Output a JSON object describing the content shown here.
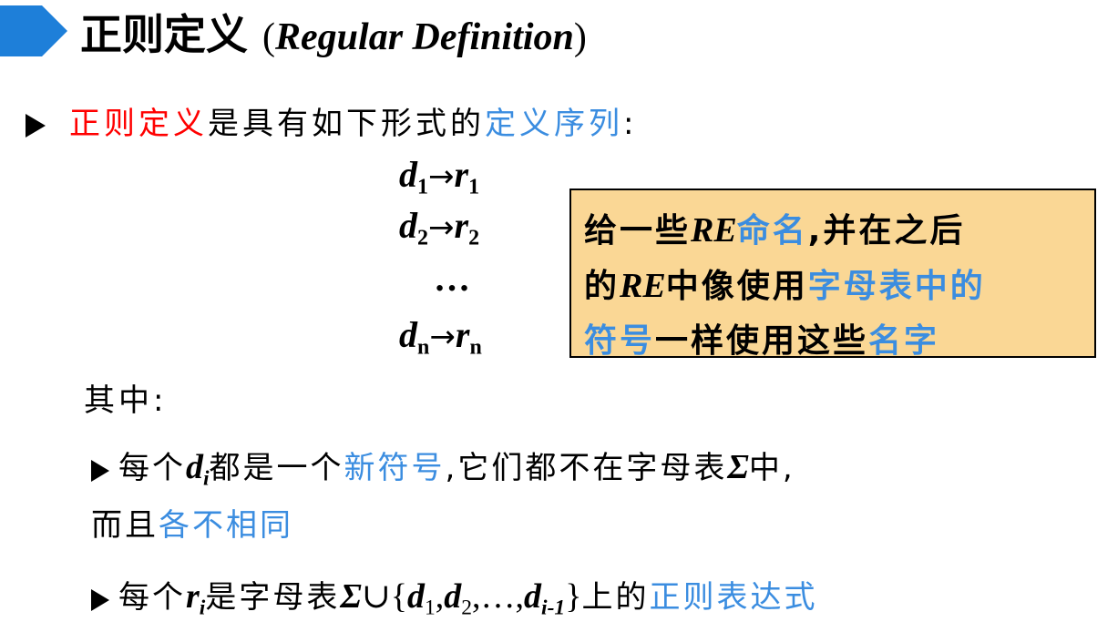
{
  "title": {
    "cn": "正则定义",
    "paren_open": "(",
    "en": "Regular Definition",
    "paren_close": ")"
  },
  "intro": {
    "term": "正则定义",
    "middle": "是具有如下形式的",
    "term2": "定义序列",
    "tail": ":"
  },
  "definitions": {
    "d": "d",
    "arrow": "→",
    "r": "r",
    "sub1": "1",
    "sub2": "2",
    "ellipsis": "…",
    "subn": "n"
  },
  "callout": {
    "p1": "给一些",
    "re1": "RE",
    "p2": "命名",
    "p3": ",并在之后",
    "p4": "的",
    "re2": "RE",
    "p5": "中像使用",
    "p6": "字母表中的",
    "p7": "符号",
    "p8": "一样使用这些",
    "p9": "名字"
  },
  "where": "其中:",
  "bullet1": {
    "p1": "每个",
    "d": "d",
    "i": "i",
    "p2": "都是一个",
    "hl": "新符号",
    "p3": ",它们都不在字母表",
    "sigma": "Σ",
    "p4": "中,",
    "p5": "而且",
    "hl2": "各不相同"
  },
  "bullet2": {
    "p1": "每个",
    "r": "r",
    "i": "i",
    "p2": "是字母表",
    "sigma": "Σ",
    "union": "∪",
    "lbrace": "{",
    "d": "d",
    "sub1": "1",
    "comma": ",",
    "sub2": "2",
    "dots": "…",
    "subi1": "i-1",
    "rbrace": "}",
    "p3": "上的",
    "hl": "正则表达式"
  },
  "colors": {
    "accent_blue": "#3b8de0",
    "accent_red": "#ff0000",
    "title_arrow": "#1e7fd9",
    "callout_bg": "#fad795"
  }
}
